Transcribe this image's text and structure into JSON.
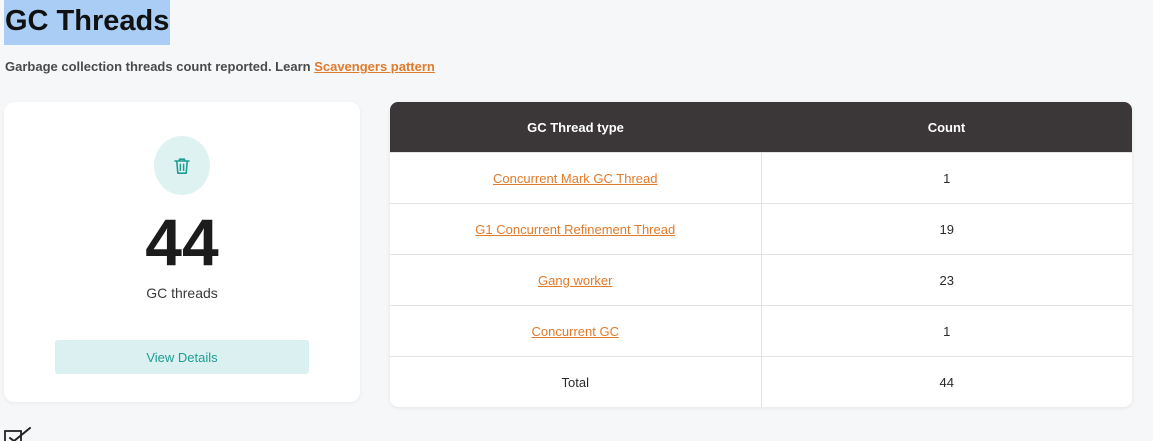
{
  "header": {
    "title": "GC Threads",
    "subtitle_text": "Garbage collection threads count reported. Learn ",
    "subtitle_link": "Scavengers pattern"
  },
  "summary": {
    "icon": "trash-icon",
    "count": "44",
    "label": "GC threads",
    "button_label": "View Details",
    "accent_color": "#1f9c93"
  },
  "table": {
    "headers": [
      "GC Thread type",
      "Count"
    ],
    "rows": [
      {
        "type": "Concurrent Mark GC Thread",
        "count": "1"
      },
      {
        "type": "G1 Concurrent Refinement Thread",
        "count": "19"
      },
      {
        "type": "Gang worker",
        "count": "23"
      },
      {
        "type": "Concurrent GC",
        "count": "1"
      }
    ],
    "total_label": "Total",
    "total_count": "44"
  },
  "colors": {
    "link": "#e07b2c",
    "table_header_bg": "#3b3739",
    "title_highlight": "#a9cdf4"
  },
  "footer": {
    "icon": "edit-icon"
  }
}
